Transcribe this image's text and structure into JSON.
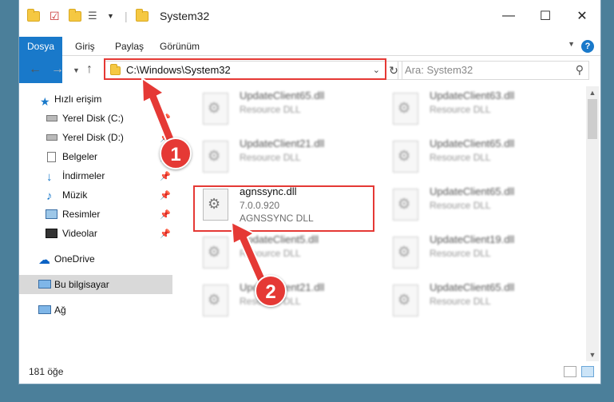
{
  "window": {
    "title": "System32"
  },
  "ribbon": {
    "tabs": [
      "Dosya",
      "Giriş",
      "Paylaş",
      "Görünüm"
    ]
  },
  "address": {
    "path": "C:\\Windows\\System32"
  },
  "search": {
    "placeholder": "Ara: System32"
  },
  "sidebar": {
    "items": [
      {
        "label": "Hızlı erişim",
        "pinned": false
      },
      {
        "label": "Yerel Disk (C:)",
        "pinned": true
      },
      {
        "label": "Yerel Disk (D:)",
        "pinned": true
      },
      {
        "label": "Belgeler",
        "pinned": true
      },
      {
        "label": "İndirmeler",
        "pinned": true
      },
      {
        "label": "Müzik",
        "pinned": true
      },
      {
        "label": "Resimler",
        "pinned": true
      },
      {
        "label": "Videolar",
        "pinned": true
      },
      {
        "label": "OneDrive",
        "pinned": false
      },
      {
        "label": "Bu bilgisayar",
        "pinned": false
      },
      {
        "label": "Ağ",
        "pinned": false
      }
    ]
  },
  "files": {
    "highlighted": {
      "name": "agnssync.dll",
      "version": "7.0.0.920",
      "desc": "AGNSSYNC DLL"
    },
    "others": [
      {
        "name": "UpdateClient65.dll",
        "desc": "Resource DLL"
      },
      {
        "name": "UpdateClient63.dll",
        "desc": "Resource DLL"
      },
      {
        "name": "UpdateClient21.dll",
        "desc": "Resource DLL"
      },
      {
        "name": "UpdateClient65.dll",
        "desc": "Resource DLL"
      },
      {
        "name": "UpdateClient65.dll",
        "desc": "Resource DLL"
      },
      {
        "name": "UpdateClient5.dll",
        "desc": "Resource DLL"
      },
      {
        "name": "UpdateClient19.dll",
        "desc": "Resource DLL"
      },
      {
        "name": "UpdateClient21.dll",
        "desc": "Resource DLL"
      },
      {
        "name": "UpdateClient65.dll",
        "desc": "Resource DLL"
      }
    ]
  },
  "status": {
    "count": "181 öğe"
  },
  "callouts": [
    "1",
    "2"
  ],
  "colors": {
    "accent": "#1979ca",
    "highlight": "#e53935"
  }
}
